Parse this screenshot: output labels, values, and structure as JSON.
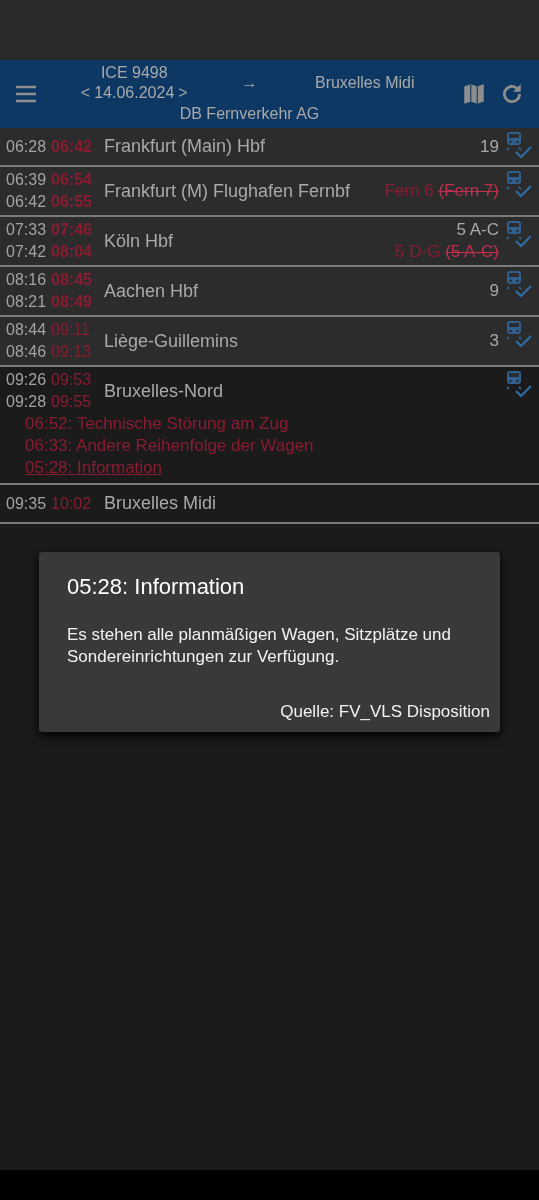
{
  "header": {
    "train": "ICE 9498",
    "date": "14.06.2024",
    "prev": "<",
    "next": ">",
    "arrow": "→",
    "destination": "Bruxelles Midi",
    "operator": "DB Fernverkehr AG"
  },
  "stops": [
    {
      "times": [
        {
          "planned": "06:28",
          "actual": "06:42"
        }
      ],
      "name": "Frankfurt (Main) Hbf",
      "platform": [
        {
          "text": "19",
          "changed": false
        }
      ],
      "passed": true,
      "bold_delay": true,
      "wagon_order": true
    },
    {
      "times": [
        {
          "planned": "06:39",
          "actual": "06:54"
        },
        {
          "planned": "06:42",
          "actual": "06:55"
        }
      ],
      "name": "Frankfurt (M) Flughafen Fernbf",
      "platform": [
        {
          "text": "Fern 6",
          "changed": true,
          "previous": "(Fern 7)"
        }
      ],
      "passed": true,
      "bold_delay": true,
      "wagon_order": true
    },
    {
      "times": [
        {
          "planned": "07:33",
          "actual": "07:46"
        },
        {
          "planned": "07:42",
          "actual": "08:04"
        }
      ],
      "name": "Köln Hbf",
      "platform": [
        {
          "text": "5 A-C",
          "changed": false
        },
        {
          "text": "5 D-G",
          "changed": true,
          "previous": "(5 A-C)"
        }
      ],
      "passed": true,
      "bold_delay": true,
      "wagon_order": true
    },
    {
      "times": [
        {
          "planned": "08:16",
          "actual": "08:45"
        },
        {
          "planned": "08:21",
          "actual": "08:49"
        }
      ],
      "name": "Aachen Hbf",
      "platform": [
        {
          "text": "9",
          "changed": false
        }
      ],
      "passed": true,
      "bold_delay": true,
      "wagon_order": true
    },
    {
      "times": [
        {
          "planned": "08:44",
          "actual": "09:11"
        },
        {
          "planned": "08:46",
          "actual": "09:13"
        }
      ],
      "name": "Liège-Guillemins",
      "platform": [
        {
          "text": "3",
          "changed": false
        }
      ],
      "passed": true,
      "bold_delay": false,
      "wagon_order": true
    },
    {
      "times": [
        {
          "planned": "09:26",
          "actual": "09:53"
        },
        {
          "planned": "09:28",
          "actual": "09:55"
        }
      ],
      "name": "Bruxelles-Nord",
      "passed": false,
      "bold_delay": false,
      "wagon_order": true,
      "messages": [
        {
          "text": "06:52: Technische Störung am Zug",
          "link": false
        },
        {
          "text": "06:33: Andere Reihenfolge der Wagen",
          "link": false
        },
        {
          "text": "05:28: Information",
          "link": true
        }
      ]
    },
    {
      "times": [
        {
          "planned": "09:35",
          "actual": "10:02"
        }
      ],
      "name": "Bruxelles Midi",
      "passed": false,
      "bold_delay": false,
      "wagon_order": false
    }
  ],
  "dialog": {
    "title": "05:28: Information",
    "body": "Es stehen alle planmäßigen Wagen, Sitzplätze und Sondereinrichtungen zur Verfügung.",
    "source": "Quelle: FV_VLS Disposition"
  }
}
